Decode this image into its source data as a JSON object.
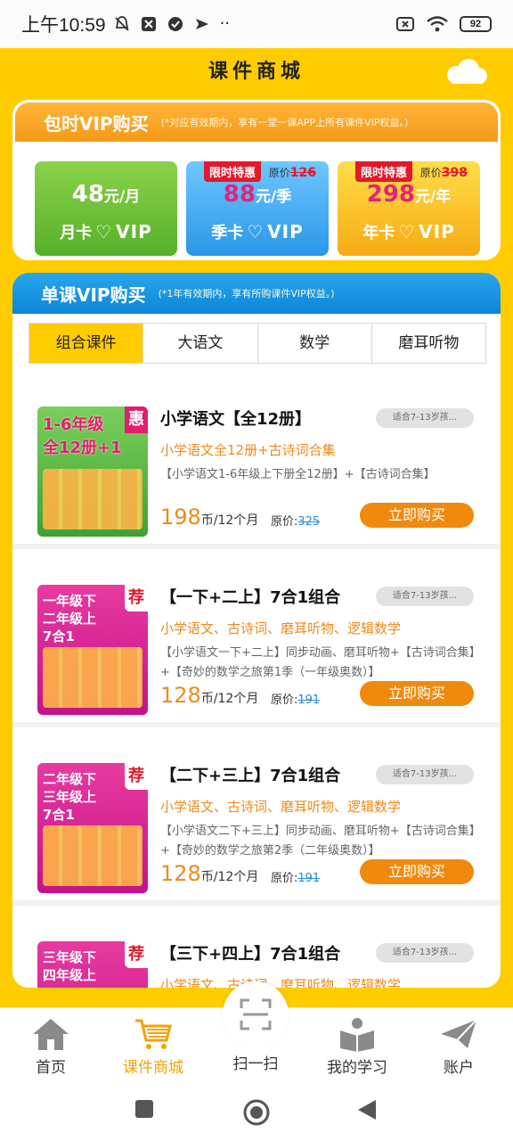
{
  "status_bar": {
    "time": "上午10:59",
    "battery": "92"
  },
  "app": {
    "title": "课件商城"
  },
  "vip_section": {
    "title": "包时VIP购买",
    "note": "(*对应有效期内，享有一堂一课APP上所有课件VIP权益。)",
    "cards": [
      {
        "price": "48",
        "unit": "元/月",
        "label": "月卡",
        "vip": "VIP",
        "badge": "",
        "orig_label": "",
        "orig": ""
      },
      {
        "price": "88",
        "unit": "元/季",
        "label": "季卡",
        "vip": "VIP",
        "badge": "限时特惠",
        "orig_label": "原价",
        "orig": "126"
      },
      {
        "price": "298",
        "unit": "元/年",
        "label": "年卡",
        "vip": "VIP",
        "badge": "限时特惠",
        "orig_label": "原价",
        "orig": "398"
      }
    ]
  },
  "course_section": {
    "title": "单课VIP购买",
    "note": "(*1年有效期内，享有所购课件VIP权益。)",
    "tabs": [
      "组合课件",
      "大语文",
      "数学",
      "磨耳听物"
    ],
    "active_tab": 0,
    "products": [
      {
        "title": "小学语文【全12册】",
        "age": "适合7-13岁孩...",
        "subtitle": "小学语文全12册+古诗词合集",
        "desc": "【小学语文1-6年级上下册全12册】+【古诗词合集】",
        "price": "198",
        "unit": "币/12个月",
        "orig_label": "原价:",
        "orig": "325",
        "buy": "立即购买",
        "thumb_text": "1-6年级\n全12册+1",
        "thumb_corner": "惠"
      },
      {
        "title": "【一下+二上】7合1组合",
        "age": "适合7-13岁孩...",
        "subtitle": "小学语文、古诗词、磨耳听物、逻辑数学",
        "desc": "【小学语文一下+二上】同步动画、磨耳听物+【古诗词合集】+【奇妙的数学之旅第1季（一年级奥数）】",
        "price": "128",
        "unit": "币/12个月",
        "orig_label": "原价:",
        "orig": "191",
        "buy": "立即购买",
        "thumb_text": "一年级下\n二年级上\n7合1",
        "thumb_corner": "荐"
      },
      {
        "title": "【二下+三上】7合1组合",
        "age": "适合7-13岁孩...",
        "subtitle": "小学语文、古诗词、磨耳听物、逻辑数学",
        "desc": "【小学语文二下+三上】同步动画、磨耳听物+【古诗词合集】+【奇妙的数学之旅第2季（二年级奥数）】",
        "price": "128",
        "unit": "币/12个月",
        "orig_label": "原价:",
        "orig": "191",
        "buy": "立即购买",
        "thumb_text": "二年级下\n三年级上\n7合1",
        "thumb_corner": "荐"
      },
      {
        "title": "【三下+四上】7合1组合",
        "age": "适合7-13岁孩...",
        "subtitle": "小学语文、古诗词、磨耳听物、逻辑数学",
        "desc": "",
        "price": "",
        "unit": "",
        "orig_label": "",
        "orig": "",
        "buy": "",
        "thumb_text": "三年级下\n四年级上",
        "thumb_corner": "荐"
      }
    ]
  },
  "bottom_nav": {
    "items": [
      {
        "label": "首页",
        "icon": "home-icon"
      },
      {
        "label": "课件商城",
        "icon": "cart-icon"
      },
      {
        "label": "扫一扫",
        "icon": "scan-icon"
      },
      {
        "label": "我的学习",
        "icon": "study-icon"
      },
      {
        "label": "账户",
        "icon": "paper-plane-icon"
      }
    ],
    "active": 1
  },
  "colors": {
    "brand_yellow": "#ffcc00",
    "accent_orange": "#f08a0d",
    "blue_header": "#0a86d6"
  }
}
